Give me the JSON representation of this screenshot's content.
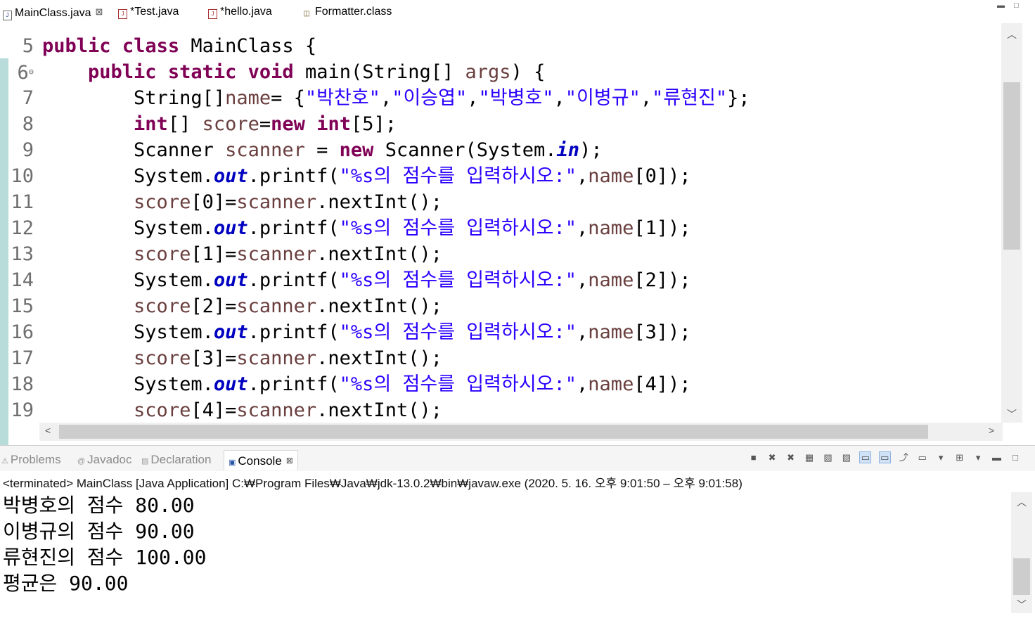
{
  "editor_tabs": [
    {
      "label": "MainClass.java",
      "active": true
    },
    {
      "label": "*Test.java"
    },
    {
      "label": "*hello.java"
    },
    {
      "label": "Formatter.class"
    }
  ],
  "code": {
    "line_numbers": [
      "5",
      "6",
      "7",
      "8",
      "9",
      "10",
      "11",
      "12",
      "13",
      "14",
      "15",
      "16",
      "17",
      "18",
      "19"
    ],
    "fold_marker": "⊖",
    "l5": {
      "kw1": "public",
      "kw2": "class",
      "rest": " MainClass {"
    },
    "l6": {
      "kw1": "public",
      "kw2": "static",
      "kw3": "void",
      "rest": " main(String[] ",
      "args": "args",
      "end": ") {"
    },
    "l7": {
      "pre": "String[]",
      "var": "name",
      "eq": "= {",
      "s1": "\"박찬호\"",
      "s2": "\"이승엽\"",
      "s3": "\"박병호\"",
      "s4": "\"이병규\"",
      "s5": "\"류현진\"",
      "end": "};"
    },
    "l8": {
      "kw1": "int",
      "mid": "[] ",
      "var": "score",
      "eq": "=",
      "kw2": "new",
      "kw3": "int",
      "end": "[5];"
    },
    "l9": {
      "pre": "Scanner ",
      "var": "scanner",
      "eq": " = ",
      "kw": "new",
      "mid": " Scanner(System.",
      "fld": "in",
      "end": ");"
    },
    "printf": {
      "pre": "System.",
      "fld": "out",
      "mid": ".printf(",
      "str": "\"%s의 점수를 입력하시오:\"",
      "comma": ",",
      "var": "name"
    },
    "idx": [
      "[0]);",
      "[1]);",
      "[2]);",
      "[3]);",
      "[4]);"
    ],
    "score_lines": [
      {
        "var": "score",
        "idx": "[0]=",
        "var2": "scanner",
        "end": ".nextInt();"
      },
      {
        "var": "score",
        "idx": "[1]=",
        "var2": "scanner",
        "end": ".nextInt();"
      },
      {
        "var": "score",
        "idx": "[2]=",
        "var2": "scanner",
        "end": ".nextInt();"
      },
      {
        "var": "score",
        "idx": "[3]=",
        "var2": "scanner",
        "end": ".nextInt();"
      },
      {
        "var": "score",
        "idx": "[4]=",
        "var2": "scanner",
        "end": ".nextInt();"
      }
    ]
  },
  "panel_tabs": [
    {
      "label": "Problems"
    },
    {
      "label": "Javadoc"
    },
    {
      "label": "Declaration"
    },
    {
      "label": "Console",
      "active": true
    }
  ],
  "console": {
    "header": "<terminated> MainClass [Java Application] C:₩Program Files₩Java₩jdk-13.0.2₩bin₩javaw.exe  (2020. 5. 16. 오후 9:01:50 – 오후 9:01:58)",
    "lines": [
      "박병호의 점수 80.00",
      "이병규의 점수 90.00",
      "류현진의 점수 100.00",
      "평균은 90.00"
    ]
  },
  "colors": {
    "keyword": "#7f0055",
    "string": "#2a00ff",
    "field": "#0000c0",
    "variable": "#6a3e3e"
  }
}
